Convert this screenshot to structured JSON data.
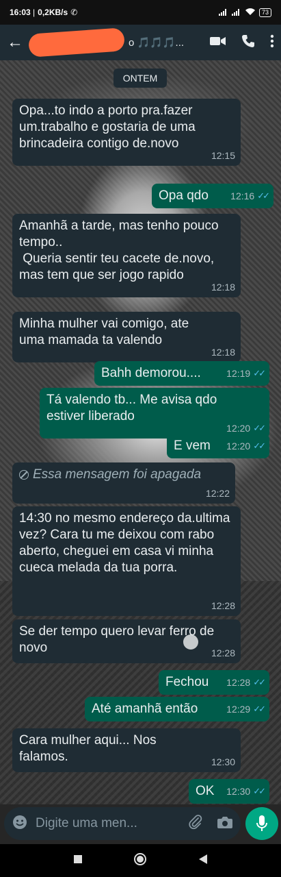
{
  "status_bar": {
    "time": "16:03",
    "network_speed": "0,2KB/s",
    "battery": "73"
  },
  "header": {
    "contact_suffix": "o 🎵🎵🎵..."
  },
  "chat": {
    "date_separator": "ONTEM",
    "messages": [
      {
        "direction": "in",
        "text": "Opa...to indo a porto pra.fazer um.trabalho e gostaria de uma brincadeira contigo de.novo",
        "time": "12:15"
      },
      {
        "direction": "out",
        "text": "Opa qdo",
        "time": "12:16"
      },
      {
        "direction": "in",
        "text": "Amanhã a tarde, mas tenho pouco tempo..\n Queria sentir teu cacete de.novo, mas tem que ser jogo rapido",
        "time": "12:18"
      },
      {
        "direction": "in",
        "text": "Minha mulher vai comigo,  ate uma mamada ta valendo",
        "time": "12:18"
      },
      {
        "direction": "out",
        "text": "Bahh demorou....",
        "time": "12:19"
      },
      {
        "direction": "out",
        "text": "Tá valendo tb... Me avisa qdo estiver liberado",
        "time": "12:20"
      },
      {
        "direction": "out",
        "text": "E vem",
        "time": "12:20"
      },
      {
        "direction": "in",
        "text": "Essa mensagem foi apagada",
        "time": "12:22",
        "deleted": true
      },
      {
        "direction": "in",
        "text": "14:30 no mesmo endereço da.ultima vez?  Cara tu me deixou com rabo aberto, cheguei em casa vi  minha cueca melada da tua porra.",
        "time": "12:28"
      },
      {
        "direction": "in",
        "text": "Se der tempo quero levar ferro de novo",
        "time": "12:28"
      },
      {
        "direction": "out",
        "text": "Fechou",
        "time": "12:28"
      },
      {
        "direction": "out",
        "text": "Até amanhã então",
        "time": "12:29"
      },
      {
        "direction": "in",
        "text": "Cara mulher aqui... Nos falamos.",
        "time": "12:30"
      },
      {
        "direction": "out",
        "text": "OK",
        "time": "12:30"
      }
    ]
  },
  "composer": {
    "placeholder": "Digite uma men..."
  },
  "colors": {
    "incoming": "#1f2c34",
    "outgoing": "#005c4b",
    "accent": "#00a884",
    "read_ticks": "#53bdeb"
  }
}
